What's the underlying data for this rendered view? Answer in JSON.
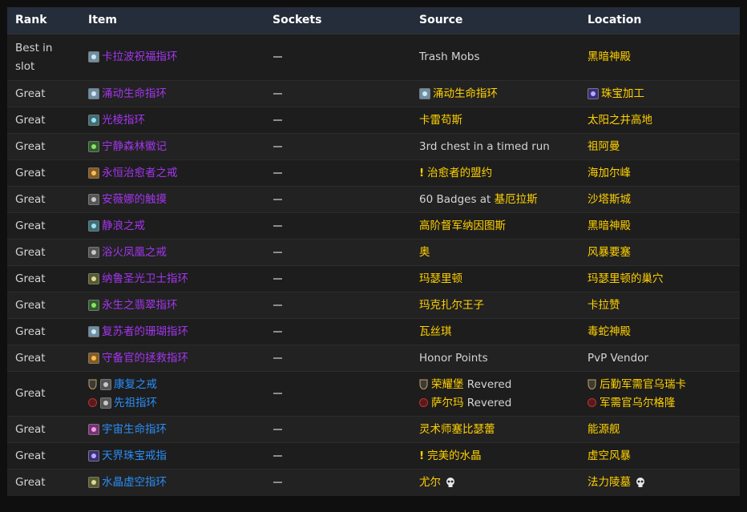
{
  "headers": {
    "rank": "Rank",
    "item": "Item",
    "sockets": "Sockets",
    "source": "Source",
    "location": "Location"
  },
  "rows": [
    {
      "rank": "Best in slot",
      "item": "卡拉波祝福指环",
      "item_icon": "ring-icon",
      "source": "Trash Mobs",
      "location": "黑暗神殿"
    },
    {
      "rank": "Great",
      "item": "涌动生命指环",
      "item_icon": "ring-icon",
      "source": "涌动生命指环",
      "source_icon": "ring-icon",
      "location": "珠宝加工",
      "location_icon": "jewelcrafting-icon"
    },
    {
      "rank": "Great",
      "item": "光棱指环",
      "item_icon": "ring-icon",
      "source": "卡雷苟斯",
      "location": "太阳之井高地"
    },
    {
      "rank": "Great",
      "item": "宁静森林徽记",
      "item_icon": "ring-icon",
      "source": "3rd chest in a timed run",
      "location": "祖阿曼"
    },
    {
      "rank": "Great",
      "item": "永恒治愈者之戒",
      "item_icon": "ring-icon",
      "source": "治愈者的盟约",
      "source_icon": "quest-icon",
      "location": "海加尔峰"
    },
    {
      "rank": "Great",
      "item": "安薇娜的触摸",
      "item_icon": "ring-icon",
      "source_pre": "60 Badges at ",
      "source": "基厄拉斯",
      "location": "沙塔斯城"
    },
    {
      "rank": "Great",
      "item": "静浪之戒",
      "item_icon": "ring-icon",
      "source": "高阶督军纳因图斯",
      "location": "黑暗神殿"
    },
    {
      "rank": "Great",
      "item": "浴火凤凰之戒",
      "item_icon": "ring-icon",
      "source": "奥",
      "location": "风暴要塞"
    },
    {
      "rank": "Great",
      "item": "纳鲁圣光卫士指环",
      "item_icon": "ring-icon",
      "source": "玛瑟里顿",
      "location": "玛瑟里顿的巢穴"
    },
    {
      "rank": "Great",
      "item": "永生之翡翠指环",
      "item_icon": "ring-icon",
      "source": "玛克扎尔王子",
      "location": "卡拉赞"
    },
    {
      "rank": "Great",
      "item": "复苏者的珊瑚指环",
      "item_icon": "ring-icon",
      "source": "瓦丝琪",
      "location": "毒蛇神殿"
    },
    {
      "rank": "Great",
      "item": "守备官的拯救指环",
      "item_icon": "ring-icon",
      "source": "Honor Points",
      "location": "PvP Vendor"
    },
    {
      "rank": "Great",
      "items": [
        {
          "name": "康复之戒",
          "icon": "ring-icon"
        },
        {
          "name": "先祖指环",
          "icon": "ring-icon"
        }
      ],
      "sources": [
        {
          "name": "荣耀堡",
          "suffix": " Revered"
        },
        {
          "name": "萨尔玛",
          "suffix": " Revered"
        }
      ],
      "locations": [
        {
          "name": "后勤军需官乌瑞卡"
        },
        {
          "name": "军需官乌尔格隆"
        }
      ]
    },
    {
      "rank": "Great",
      "item": "宇宙生命指环",
      "item_icon": "ring-icon",
      "source": "灵术师塞比瑟蕾",
      "location": "能源舰"
    },
    {
      "rank": "Great",
      "item": "天界珠宝戒指",
      "item_icon": "ring-icon",
      "source": "完美的水晶",
      "source_icon": "quest-icon",
      "location": "虚空风暴"
    },
    {
      "rank": "Great",
      "item": "水晶虚空指环",
      "item_icon": "ring-icon",
      "source": "尤尔",
      "source_icon_after": "skull-icon",
      "location": "法力陵墓",
      "location_icon_after": "skull-icon"
    }
  ],
  "colors": {
    "epic": "#a335ee",
    "rare": "#2a8df5",
    "gold": "#ffd100",
    "header_bg": "#252c3a"
  }
}
